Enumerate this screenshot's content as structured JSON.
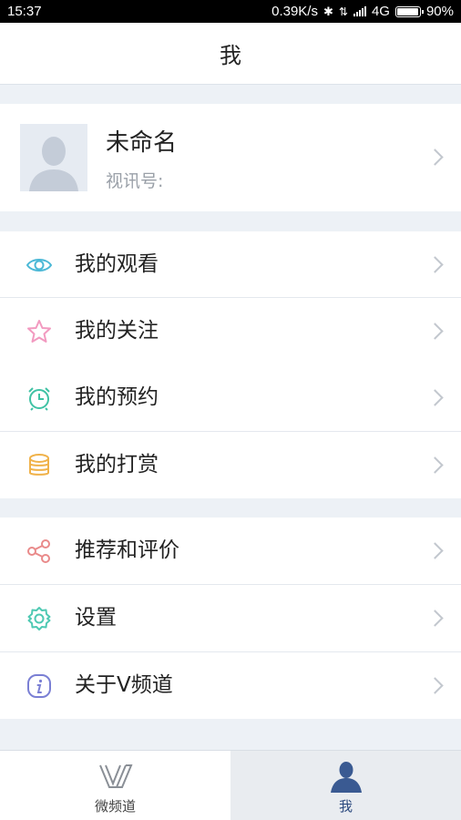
{
  "status_bar": {
    "time": "15:37",
    "speed": "0.39K/s",
    "network": "4G",
    "battery": "90%"
  },
  "header": {
    "title": "我"
  },
  "profile": {
    "name": "未命名",
    "id_label": "视讯号:"
  },
  "menu_group1": [
    {
      "label": "我的观看",
      "icon": "eye-icon"
    },
    {
      "label": "我的关注",
      "icon": "star-icon"
    },
    {
      "label": "我的预约",
      "icon": "alarm-clock-icon"
    },
    {
      "label": "我的打赏",
      "icon": "coins-icon"
    }
  ],
  "menu_group2": [
    {
      "label": "推荐和评价",
      "icon": "share-icon"
    },
    {
      "label": "设置",
      "icon": "gear-icon"
    },
    {
      "label": "关于V频道",
      "icon": "info-icon"
    }
  ],
  "tabs": [
    {
      "label": "微频道",
      "icon": "v-logo-icon",
      "active": false
    },
    {
      "label": "我",
      "icon": "person-icon",
      "active": true
    }
  ],
  "colors": {
    "eye": "#4bb8d6",
    "star": "#f29ac0",
    "alarm": "#3fc2a4",
    "coins": "#f0b24a",
    "share": "#e98a8a",
    "gear": "#4fc9b3",
    "info": "#7a7fd4",
    "active_tab": "#2c4a7f"
  }
}
